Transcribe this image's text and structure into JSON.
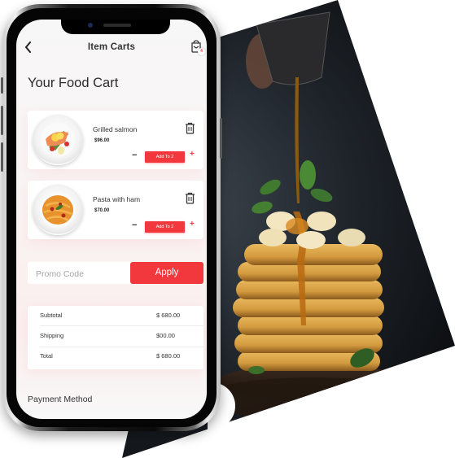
{
  "header": {
    "back_icon": "chevron-left-icon",
    "title": "Item Carts",
    "cart_icon": "shopping-bag-icon",
    "cart_badge": "4"
  },
  "page_title": "Your Food Cart",
  "cart_items": [
    {
      "name": "Grilled salmon",
      "price": "$96.00",
      "image": "grilled-salmon-plate",
      "add_label": "Add To 2",
      "minus": "−",
      "plus": "+"
    },
    {
      "name": "Pasta with ham",
      "price": "$70.00",
      "image": "pasta-plate",
      "add_label": "Add To 2",
      "minus": "−",
      "plus": "+"
    }
  ],
  "promo": {
    "placeholder": "Promo Code",
    "value": "",
    "apply_label": "Apply"
  },
  "summary": [
    {
      "label": "Subtotal",
      "value": "$ 680.00"
    },
    {
      "label": "Shipping",
      "value": "$00.00"
    },
    {
      "label": "Total",
      "value": "$ 680.00"
    }
  ],
  "payment_method_label": "Payment Method",
  "colors": {
    "accent": "#f2383d",
    "text": "#333333",
    "background": "#f7f7f7"
  },
  "background_photo": "pancake-stack-with-syrup"
}
